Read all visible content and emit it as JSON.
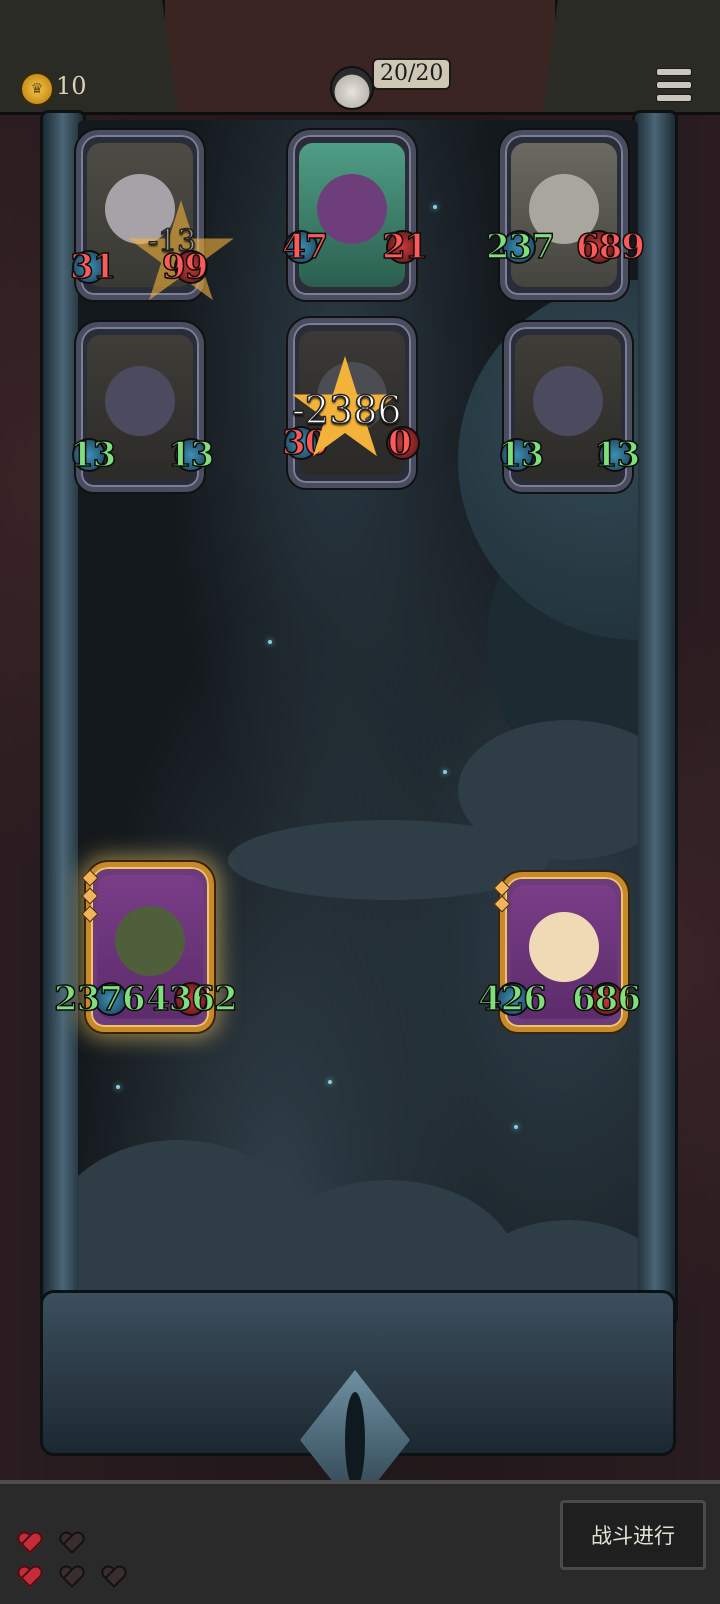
{
  "header": {
    "coins": "10",
    "hp_text": "20/20",
    "menu_icon": "hamburger-menu-icon"
  },
  "enemies": [
    {
      "name": "rat-king",
      "attack": "31",
      "health": "99",
      "attack_color": "red",
      "health_color": "red",
      "damage_popup": "-13"
    },
    {
      "name": "witch",
      "attack": "47",
      "health": "21",
      "attack_color": "red",
      "health_color": "red"
    },
    {
      "name": "stone-man",
      "attack": "237",
      "health": "689",
      "attack_color": "green",
      "health_color": "red"
    },
    {
      "name": "mouse-left",
      "attack": "13",
      "health": "13",
      "attack_color": "green",
      "health_color": "green"
    },
    {
      "name": "wolf",
      "attack": "30",
      "health": "0",
      "attack_color": "red",
      "health_color": "red",
      "damage_popup": "-2386"
    },
    {
      "name": "mouse-right",
      "attack": "13",
      "health": "13",
      "attack_color": "green",
      "health_color": "green"
    }
  ],
  "allies": [
    {
      "name": "goblin-scarecrow",
      "attack": "2376",
      "health": "4362"
    },
    {
      "name": "leaf-girl",
      "attack": "426",
      "health": "686"
    }
  ],
  "lives": {
    "total": 5,
    "full": 2
  },
  "battle_button_label": "战斗进行",
  "colors": {
    "green_stat": "#7fe07b",
    "red_stat": "#ff5959",
    "gold_frame": "#c78a2b"
  }
}
